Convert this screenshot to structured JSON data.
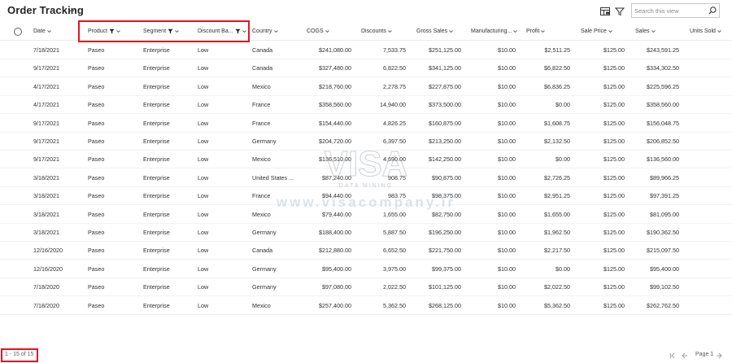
{
  "app": {
    "title": "Order Tracking"
  },
  "toolbar": {
    "search_placeholder": "Search this view",
    "view_icon": "table-view-icon",
    "filter_icon": "filter-icon",
    "search_icon": "search-icon"
  },
  "table": {
    "columns": [
      {
        "label": "Date",
        "filtered": false
      },
      {
        "label": "Product",
        "filtered": true
      },
      {
        "label": "Segment",
        "filtered": true
      },
      {
        "label": "Discount Ba...",
        "filtered": true
      },
      {
        "label": "Country",
        "filtered": false
      },
      {
        "label": "COGS",
        "filtered": false
      },
      {
        "label": "Discounts",
        "filtered": false
      },
      {
        "label": "Gross Sales",
        "filtered": false
      },
      {
        "label": "Manufacturing...",
        "filtered": false
      },
      {
        "label": "Profit",
        "filtered": false
      },
      {
        "label": "Sale Price",
        "filtered": false
      },
      {
        "label": "Sales",
        "filtered": false
      },
      {
        "label": "Units Sold",
        "filtered": false
      }
    ],
    "rows": [
      [
        "7/18/2021",
        "Paseo",
        "Enterprise",
        "Low",
        "Canada",
        "$241,080.00",
        "7,533.75",
        "$251,125.00",
        "$10.00",
        "$2,511.25",
        "$125.00",
        "$243,591.25"
      ],
      [
        "9/17/2021",
        "Paseo",
        "Enterprise",
        "Low",
        "Canada",
        "$327,480.00",
        "6,822.50",
        "$341,125.00",
        "$10.00",
        "$6,822.50",
        "$125.00",
        "$334,302.50"
      ],
      [
        "4/17/2021",
        "Paseo",
        "Enterprise",
        "Low",
        "Mexico",
        "$218,760.00",
        "2,278.75",
        "$227,875.00",
        "$10.00",
        "$6,836.25",
        "$125.00",
        "$225,596.25"
      ],
      [
        "4/17/2021",
        "Paseo",
        "Enterprise",
        "Low",
        "France",
        "$358,560.00",
        "14,940.00",
        "$373,500.00",
        "$10.00",
        "$0.00",
        "$125.00",
        "$358,560.00"
      ],
      [
        "9/17/2021",
        "Paseo",
        "Enterprise",
        "Low",
        "France",
        "$154,440.00",
        "4,826.25",
        "$160,875.00",
        "$10.00",
        "$1,608.75",
        "$125.00",
        "$156,048.75"
      ],
      [
        "9/17/2021",
        "Paseo",
        "Enterprise",
        "Low",
        "Germany",
        "$204,720.00",
        "6,397.50",
        "$213,250.00",
        "$10.00",
        "$2,132.50",
        "$125.00",
        "$206,852.50"
      ],
      [
        "9/17/2021",
        "Paseo",
        "Enterprise",
        "Low",
        "Mexico",
        "$136,510.00",
        "4,690.00",
        "$142,250.00",
        "$10.00",
        "$0.00",
        "$125.00",
        "$136,560.00"
      ],
      [
        "3/18/2021",
        "Paseo",
        "Enterprise",
        "Low",
        "United States ...",
        "$87,240.00",
        "908.75",
        "$90,875.00",
        "$10.00",
        "$2,726.25",
        "$125.00",
        "$89,966.25"
      ],
      [
        "3/18/2021",
        "Paseo",
        "Enterprise",
        "Low",
        "France",
        "$94,440.00",
        "983.75",
        "$98,375.00",
        "$10.00",
        "$2,951.25",
        "$125.00",
        "$97,391.25"
      ],
      [
        "3/18/2021",
        "Paseo",
        "Enterprise",
        "Low",
        "Mexico",
        "$79,440.00",
        "1,655.00",
        "$82,750.00",
        "$10.00",
        "$1,655.00",
        "$125.00",
        "$81,095.00"
      ],
      [
        "3/18/2021",
        "Paseo",
        "Enterprise",
        "Low",
        "Germany",
        "$188,400.00",
        "5,887.50",
        "$196,250.00",
        "$10.00",
        "$1,962.50",
        "$125.00",
        "$190,362.50"
      ],
      [
        "12/16/2020",
        "Paseo",
        "Enterprise",
        "Low",
        "Canada",
        "$212,880.00",
        "6,652.50",
        "$221,750.00",
        "$10.00",
        "$2,217.50",
        "$125.00",
        "$215,097.50"
      ],
      [
        "12/16/2020",
        "Paseo",
        "Enterprise",
        "Low",
        "Germany",
        "$95,400.00",
        "3,975.00",
        "$99,375.00",
        "$10.00",
        "$0.00",
        "$125.00",
        "$95,400.00"
      ],
      [
        "7/18/2020",
        "Paseo",
        "Enterprise",
        "Low",
        "Germany",
        "$97,080.00",
        "2,022.50",
        "$101,125.00",
        "$10.00",
        "$2,022.50",
        "$125.00",
        "$99,102.50"
      ],
      [
        "7/18/2020",
        "Paseo",
        "Enterprise",
        "Low",
        "Mexico",
        "$257,400.00",
        "5,362.50",
        "$268,125.00",
        "$10.00",
        "$5,362.50",
        "$125.00",
        "$262,762.50"
      ]
    ]
  },
  "footer": {
    "record_count": "1 - 15 of 15",
    "page_label": "Page 1"
  },
  "watermark": {
    "logo_text": "VISA",
    "sub_text": "DATA MINING",
    "url_text": "www.visacompany.ir"
  },
  "colors": {
    "highlight": "#e81123"
  }
}
